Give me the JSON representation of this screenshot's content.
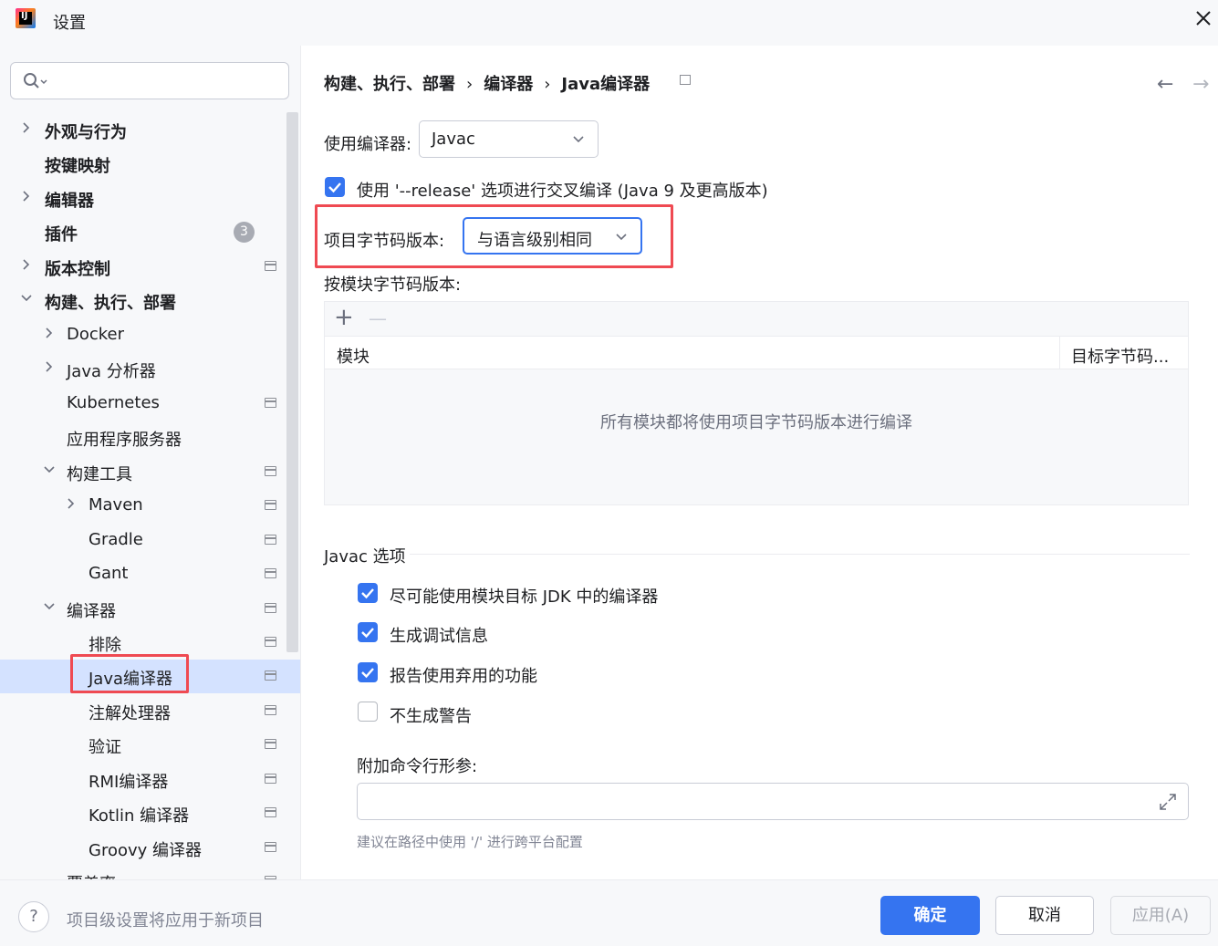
{
  "window": {
    "title": "设置"
  },
  "search": {
    "placeholder": ""
  },
  "sidebar": {
    "items": [
      {
        "label": "外观与行为"
      },
      {
        "label": "按键映射"
      },
      {
        "label": "编辑器"
      },
      {
        "label": "插件",
        "badge": "3"
      },
      {
        "label": "版本控制"
      },
      {
        "label": "构建、执行、部署"
      },
      {
        "label": "Docker"
      },
      {
        "label": "Java 分析器"
      },
      {
        "label": "Kubernetes"
      },
      {
        "label": "应用程序服务器"
      },
      {
        "label": "构建工具"
      },
      {
        "label": "Maven"
      },
      {
        "label": "Gradle"
      },
      {
        "label": "Gant"
      },
      {
        "label": "编译器"
      },
      {
        "label": "排除"
      },
      {
        "label": "Java编译器"
      },
      {
        "label": "注解处理器"
      },
      {
        "label": "验证"
      },
      {
        "label": "RMI编译器"
      },
      {
        "label": "Kotlin 编译器"
      },
      {
        "label": "Groovy 编译器"
      },
      {
        "label": "覆盖率"
      }
    ]
  },
  "breadcrumb": {
    "items": [
      "构建、执行、部署",
      "编译器",
      "Java编译器"
    ],
    "separator": "›"
  },
  "nav": {
    "back": "←",
    "forward": "→"
  },
  "form": {
    "compiler_label": "使用编译器:",
    "compiler_value": "Javac",
    "release_option_label": "使用 '--release' 选项进行交叉编译 (Java 9 及更高版本)",
    "release_option_checked": true,
    "bytecode_label": "项目字节码版本:",
    "bytecode_value": "与语言级别相同",
    "per_module_label": "按模块字节码版本:",
    "table": {
      "add": "+",
      "remove": "—",
      "columns": [
        "模块",
        "目标字节码..."
      ],
      "empty_text": "所有模块都将使用项目字节码版本进行编译"
    },
    "javac_section_title": "Javac 选项",
    "javac_options": [
      {
        "label": "尽可能使用模块目标 JDK 中的编译器",
        "checked": true
      },
      {
        "label": "生成调试信息",
        "checked": true
      },
      {
        "label": "报告使用弃用的功能",
        "checked": true
      },
      {
        "label": "不生成警告",
        "checked": false
      }
    ],
    "extra_params_label": "附加命令行形参:",
    "extra_params_value": "",
    "hint": "建议在路径中使用 '/' 进行跨平台配置"
  },
  "footer": {
    "help": "?",
    "note": "项目级设置将应用于新项目",
    "ok": "确定",
    "cancel": "取消",
    "apply": "应用(A)"
  },
  "colors": {
    "accent": "#3574f0",
    "highlight_box": "#ef4a52",
    "selected_row": "#d4e2ff"
  }
}
